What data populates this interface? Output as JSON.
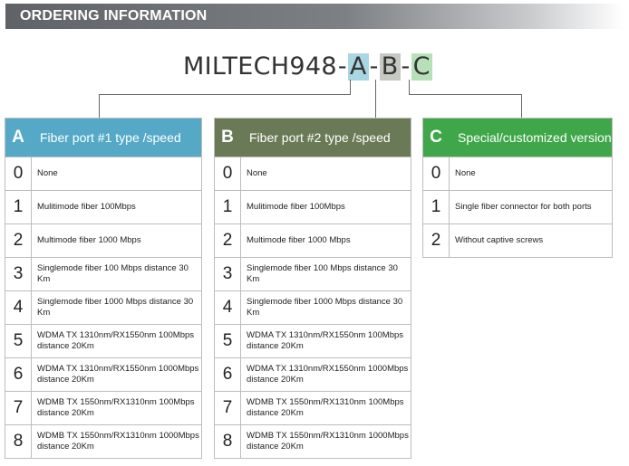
{
  "header": {
    "title": "ORDERING INFORMATION"
  },
  "model": {
    "base": "MILTECH948",
    "dash": "-",
    "seg_a": "A",
    "seg_b": "B",
    "seg_c": "C"
  },
  "colors": {
    "table_a": "#55a9c7",
    "table_b": "#6b7a56",
    "table_c": "#3fa74a"
  },
  "tables": [
    {
      "letter": "A",
      "title": "Fiber port #1 type /speed",
      "rows": [
        {
          "num": "0",
          "desc": "None"
        },
        {
          "num": "1",
          "desc": "Mulitimode fiber 100Mbps"
        },
        {
          "num": "2",
          "desc": "Multimode fiber 1000 Mbps"
        },
        {
          "num": "3",
          "desc": "Singlemode fiber 100 Mbps distance  30 Km"
        },
        {
          "num": "4",
          "desc": "Singlemode fiber 1000 Mbps distance 30 Km"
        },
        {
          "num": "5",
          "desc": "WDMA TX 1310nm/RX1550nm 100Mbps distance  20Km"
        },
        {
          "num": "6",
          "desc": "WDMA TX 1310nm/RX1550nm 1000Mbps distance  20Km"
        },
        {
          "num": "7",
          "desc": "WDMB TX 1550nm/RX1310nm 100Mbps distance  20Km"
        },
        {
          "num": "8",
          "desc": "WDMB TX 1550nm/RX1310nm 1000Mbps distance  20Km"
        }
      ]
    },
    {
      "letter": "B",
      "title": "Fiber port #2 type /speed",
      "rows": [
        {
          "num": "0",
          "desc": "None"
        },
        {
          "num": "1",
          "desc": "Mulitimode fiber 100Mbps"
        },
        {
          "num": "2",
          "desc": "Multimode fiber 1000 Mbps"
        },
        {
          "num": "3",
          "desc": "Singlemode fiber 100 Mbps distance  30 Km"
        },
        {
          "num": "4",
          "desc": "Singlemode fiber 1000 Mbps distance 30 Km"
        },
        {
          "num": "5",
          "desc": "WDMA TX 1310nm/RX1550nm 100Mbps distance  20Km"
        },
        {
          "num": "6",
          "desc": "WDMA TX 1310nm/RX1550nm 1000Mbps distance  20Km"
        },
        {
          "num": "7",
          "desc": "WDMB TX 1550nm/RX1310nm 100Mbps distance  20Km"
        },
        {
          "num": "8",
          "desc": "WDMB TX 1550nm/RX1310nm 1000Mbps distance  20Km"
        }
      ]
    },
    {
      "letter": "C",
      "title": "Special/customized version",
      "rows": [
        {
          "num": "0",
          "desc": "None"
        },
        {
          "num": "1",
          "desc": "Single fiber connector for both ports"
        },
        {
          "num": "2",
          "desc": "Without captive screws"
        }
      ]
    }
  ]
}
